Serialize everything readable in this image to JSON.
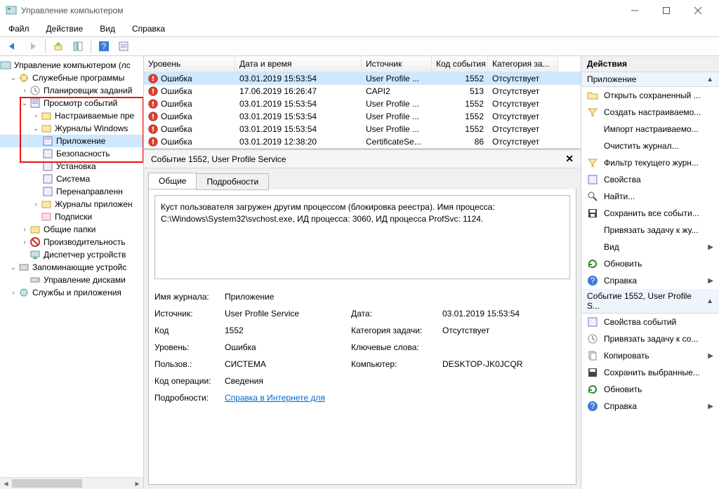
{
  "window": {
    "title": "Управление компьютером"
  },
  "menu": {
    "file": "Файл",
    "action": "Действие",
    "view": "Вид",
    "help": "Справка"
  },
  "tree": {
    "root": "Управление компьютером (лс",
    "system_tools": "Служебные программы",
    "task_scheduler": "Планировщик заданий",
    "event_viewer": "Просмотр событий",
    "custom_views": "Настраиваемые пре",
    "windows_logs": "Журналы Windows",
    "application": "Приложение",
    "security": "Безопасность",
    "setup": "Установка",
    "system": "Система",
    "forwarded": "Перенаправленн",
    "app_logs": "Журналы приложен",
    "subscriptions": "Подписки",
    "shared_folders": "Общие папки",
    "performance": "Производительность",
    "device_manager": "Диспетчер устройств",
    "storage": "Запоминающие устройс",
    "disk_mgmt": "Управление дисками",
    "services_apps": "Службы и приложения"
  },
  "columns": {
    "level": "Уровень",
    "datetime": "Дата и время",
    "source": "Источник",
    "eventid": "Код события",
    "category": "Категория за..."
  },
  "events": [
    {
      "level": "Ошибка",
      "dt": "03.01.2019 15:53:54",
      "src": "User Profile ...",
      "id": "1552",
      "cat": "Отсутствует"
    },
    {
      "level": "Ошибка",
      "dt": "17.06.2019 16:26:47",
      "src": "CAPI2",
      "id": "513",
      "cat": "Отсутствует"
    },
    {
      "level": "Ошибка",
      "dt": "03.01.2019 15:53:54",
      "src": "User Profile ...",
      "id": "1552",
      "cat": "Отсутствует"
    },
    {
      "level": "Ошибка",
      "dt": "03.01.2019 15:53:54",
      "src": "User Profile ...",
      "id": "1552",
      "cat": "Отсутствует"
    },
    {
      "level": "Ошибка",
      "dt": "03.01.2019 15:53:54",
      "src": "User Profile ...",
      "id": "1552",
      "cat": "Отсутствует"
    },
    {
      "level": "Ошибка",
      "dt": "03.01.2019 12:38:20",
      "src": "CertificateSe...",
      "id": "86",
      "cat": "Отсутствует"
    }
  ],
  "detail": {
    "title": "Событие 1552, User Profile Service",
    "tab_general": "Общие",
    "tab_details": "Подробности",
    "message": "Куст пользователя загружен другим процессом (блокировка реестра). Имя процесса: C:\\Windows\\System32\\svchost.exe, ИД процесса: 3060, ИД процесса ProfSvc: 1124.",
    "labels": {
      "journal": "Имя журнала:",
      "source": "Источник:",
      "code": "Код",
      "level": "Уровень:",
      "user": "Пользов.:",
      "opcode": "Код операции:",
      "more": "Подробности:",
      "date": "Дата:",
      "taskcat": "Категория задачи:",
      "keywords": "Ключевые слова:",
      "computer": "Компьютер:"
    },
    "values": {
      "journal": "Приложение",
      "source": "User Profile Service",
      "code": "1552",
      "level": "Ошибка",
      "user": "СИСТЕМА",
      "opcode": "Сведения",
      "more": "Справка в Интернете для",
      "date": "03.01.2019 15:53:54",
      "taskcat": "Отсутствует",
      "keywords": "",
      "computer": "DESKTOP-JK0JCQR"
    }
  },
  "actions": {
    "header": "Действия",
    "group1": "Приложение",
    "open_saved": "Открыть сохраненный ...",
    "create_custom": "Создать настраиваемо...",
    "import_custom": "Импорт настраиваемо...",
    "clear_log": "Очистить журнал...",
    "filter_log": "Фильтр текущего журн...",
    "properties": "Свойства",
    "find": "Найти...",
    "save_all": "Сохранить все событи...",
    "attach_task": "Привязать задачу к жу...",
    "view": "Вид",
    "refresh": "Обновить",
    "help": "Справка",
    "group2": "Событие 1552, User Profile S...",
    "event_props": "Свойства событий",
    "attach_task2": "Привязать задачу к со...",
    "copy": "Копировать",
    "save_selected": "Сохранить выбранные...",
    "refresh2": "Обновить",
    "help2": "Справка"
  }
}
